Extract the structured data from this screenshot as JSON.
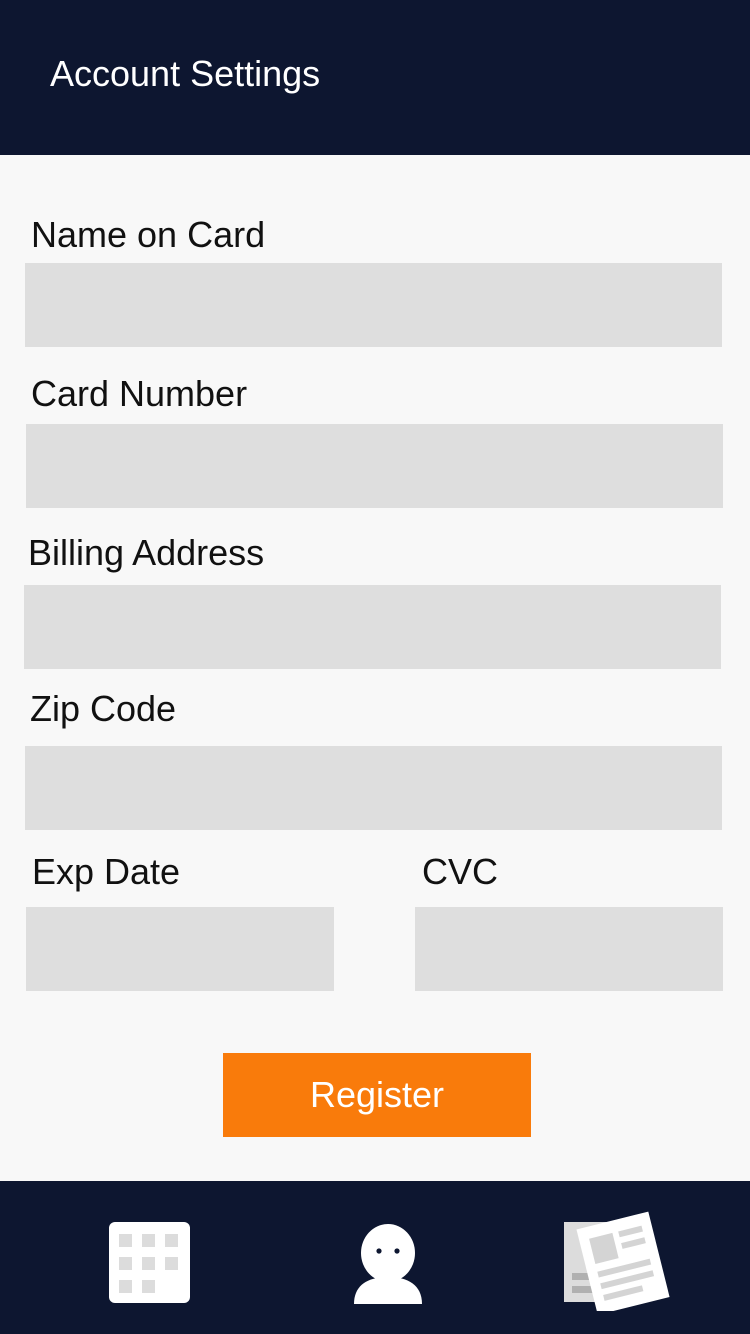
{
  "header": {
    "title": "Account Settings"
  },
  "form": {
    "name_on_card": {
      "label": "Name on Card",
      "value": "",
      "placeholder": ""
    },
    "card_number": {
      "label": "Card Number",
      "value": "",
      "placeholder": ""
    },
    "billing_address": {
      "label": "Billing Address",
      "value": "",
      "placeholder": ""
    },
    "zip_code": {
      "label": "Zip Code",
      "value": "",
      "placeholder": ""
    },
    "exp_date": {
      "label": "Exp Date",
      "value": "",
      "placeholder": ""
    },
    "cvc": {
      "label": "CVC",
      "value": "",
      "placeholder": ""
    },
    "register_label": "Register"
  },
  "tabbar": {
    "tabs": [
      {
        "icon": "calendar-grid-icon"
      },
      {
        "icon": "user-profile-icon"
      },
      {
        "icon": "newspaper-icon"
      }
    ]
  },
  "colors": {
    "header_bg": "#0d1630",
    "field_bg": "#dedede",
    "accent": "#f97b0b",
    "page_bg": "#f8f8f8"
  }
}
